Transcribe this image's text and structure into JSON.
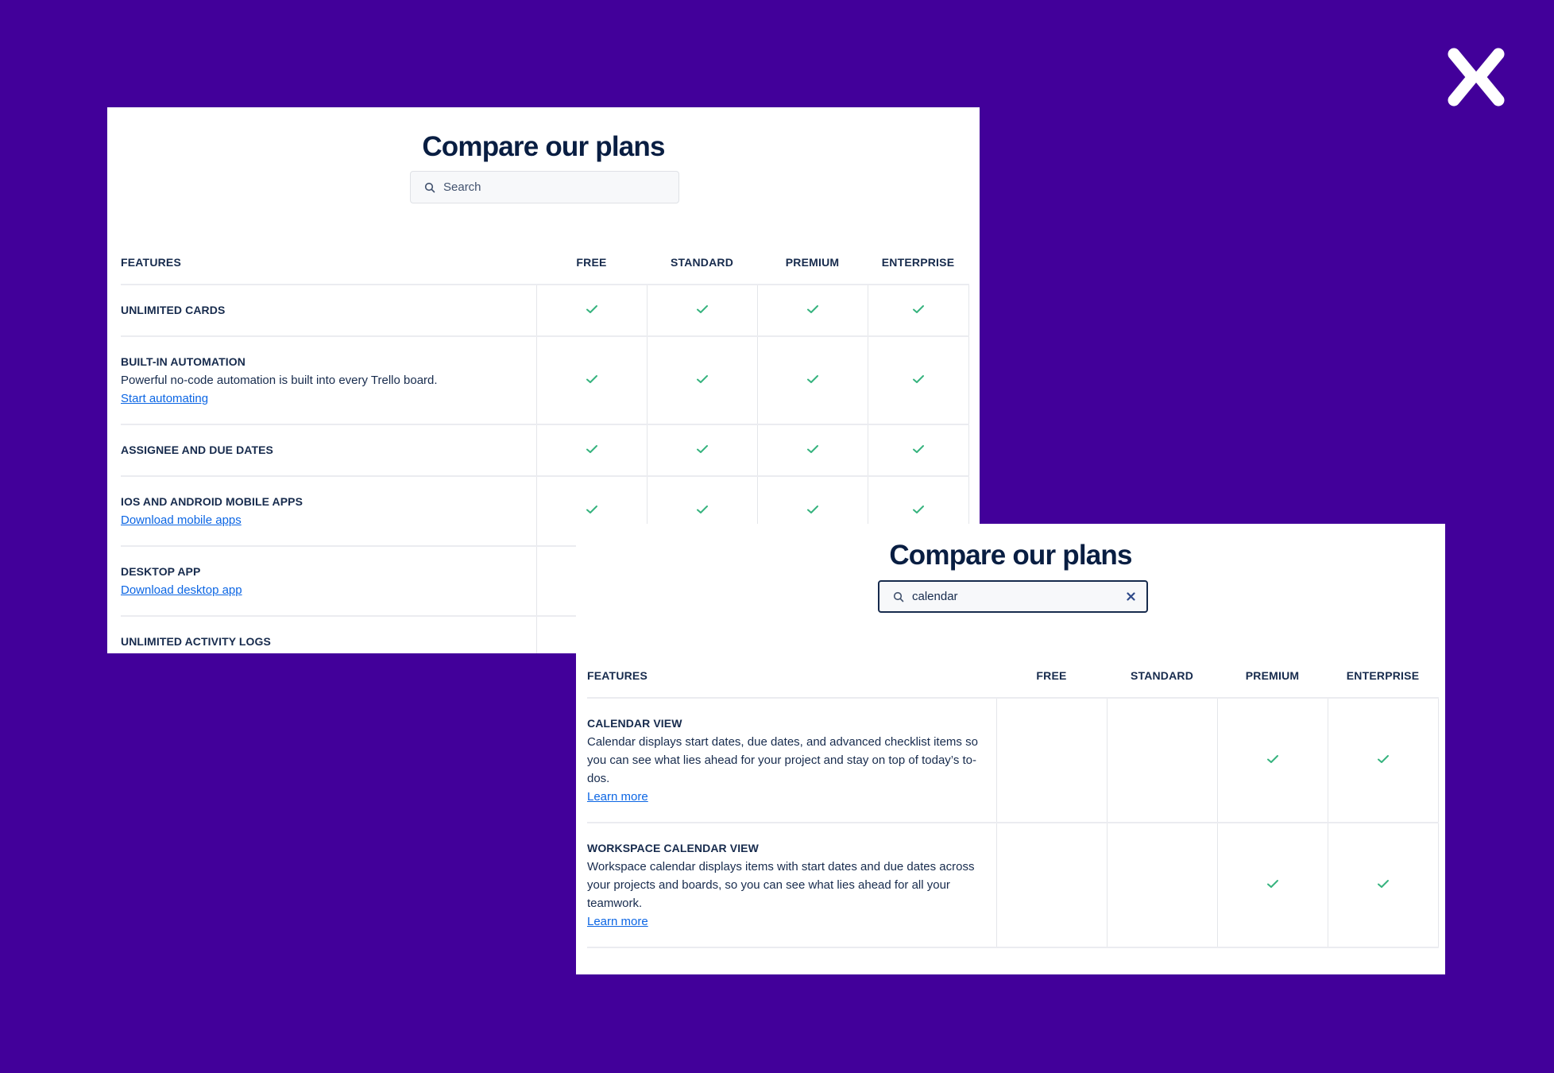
{
  "brand": {
    "background": "#42009a",
    "logo_icon": "chevron-x-logo-icon"
  },
  "panel_default": {
    "title": "Compare our plans",
    "search": {
      "value": "",
      "placeholder": "Search",
      "icon": "search-icon"
    },
    "columns": [
      "FEATURES",
      "FREE",
      "STANDARD",
      "PREMIUM",
      "ENTERPRISE"
    ],
    "rows": [
      {
        "name": "UNLIMITED CARDS",
        "description": "",
        "link": "",
        "plans": [
          true,
          true,
          true,
          true
        ]
      },
      {
        "name": "BUILT-IN AUTOMATION",
        "description": "Powerful no-code automation is built into every Trello board.",
        "link": "Start automating",
        "plans": [
          true,
          true,
          true,
          true
        ]
      },
      {
        "name": "ASSIGNEE AND DUE DATES",
        "description": "",
        "link": "",
        "plans": [
          true,
          true,
          true,
          true
        ]
      },
      {
        "name": "IOS AND ANDROID MOBILE APPS",
        "description": "",
        "link": "Download mobile apps",
        "plans": [
          true,
          true,
          true,
          true
        ]
      },
      {
        "name": "DESKTOP APP",
        "description": "",
        "link": "Download desktop app",
        "plans": [
          null,
          null,
          null,
          null
        ]
      },
      {
        "name": "UNLIMITED ACTIVITY LOGS",
        "description": "",
        "link": "",
        "plans": [
          null,
          null,
          null,
          null
        ]
      }
    ]
  },
  "panel_filtered": {
    "title": "Compare our plans",
    "search": {
      "value": "calendar",
      "placeholder": "Search",
      "icon": "search-icon",
      "clear_label": "×"
    },
    "columns": [
      "FEATURES",
      "FREE",
      "STANDARD",
      "PREMIUM",
      "ENTERPRISE"
    ],
    "rows": [
      {
        "name": "CALENDAR VIEW",
        "description": "Calendar displays start dates, due dates, and advanced checklist items so you can see what lies ahead for your project and stay on top of today’s to-dos.",
        "link": "Learn more",
        "plans": [
          false,
          false,
          true,
          true
        ]
      },
      {
        "name": "WORKSPACE CALENDAR VIEW",
        "description": "Workspace calendar displays items with start dates and due dates across your projects and boards, so you can see what lies ahead for all your teamwork.",
        "link": "Learn more",
        "plans": [
          false,
          false,
          true,
          true
        ]
      }
    ]
  },
  "colors": {
    "check": "#36b37e",
    "link": "#0c66e4",
    "heading": "#091e42"
  }
}
